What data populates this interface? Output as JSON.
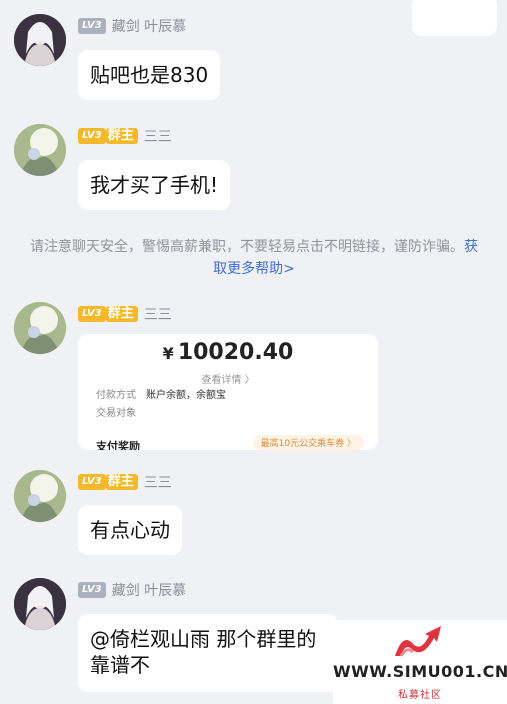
{
  "messages": [
    {
      "level": "LV3",
      "role": "",
      "name": "藏剑 叶辰慕",
      "text": "贴吧也是830"
    },
    {
      "level": "LV3",
      "role": "群主",
      "name": "三三",
      "text": "我才买了手机!"
    },
    {
      "level": "LV3",
      "role": "群主",
      "name": "三三",
      "text": ""
    },
    {
      "level": "LV3",
      "role": "群主",
      "name": "三三",
      "text": "有点心动"
    },
    {
      "level": "LV3",
      "role": "",
      "name": "藏剑 叶辰慕",
      "text_line1": "@倚栏观山雨 那个群里的",
      "text_line2": "靠谱不"
    }
  ],
  "notice": {
    "text": "请注意聊天安全，警惕高薪兼职，不要轻易点击不明链接，谨防诈骗。",
    "link": "获取更多帮助>"
  },
  "payment": {
    "currency": "¥",
    "amount": "10020.40",
    "detail_link": "查看详情 〉",
    "method_label": "付款方式",
    "method_value": "账户余额，余额宝",
    "party_label": "交易对象",
    "reward_label": "支付奖励",
    "reward_value": "最高10元公交乘车券 〉"
  },
  "watermark": {
    "brand": "WWW.SIMU001.CN",
    "sub": "私募社区"
  },
  "colors": {
    "background": "#f0f1f5",
    "owner_badge": "#f3b92b",
    "link": "#3f6fd8"
  }
}
